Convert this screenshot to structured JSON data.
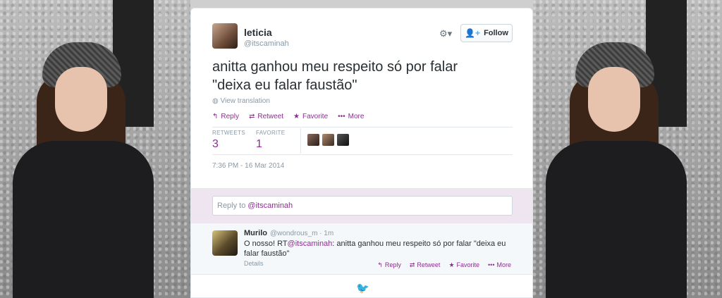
{
  "tweet": {
    "author_name": "leticia",
    "author_handle": "@itscaminah",
    "follow_label": "Follow",
    "text_line1": "anitta ganhou meu respeito só por falar",
    "text_line2": "\"deixa eu falar faustão\"",
    "view_translation": "View translation",
    "actions": {
      "reply": "Reply",
      "retweet": "Retweet",
      "favorite": "Favorite",
      "more": "More"
    },
    "stats": {
      "retweets_label": "RETWEETS",
      "retweets_count": "3",
      "favorites_label": "FAVORITE",
      "favorites_count": "1"
    },
    "timestamp": "7:36 PM - 16 Mar 2014"
  },
  "reply_box": {
    "prefix": "Reply to ",
    "mention": "@itscaminah"
  },
  "reply_tweet": {
    "author_name": "Murilo",
    "author_handle": "@wondrous_m · 1m",
    "text_before": "O nosso! RT",
    "mention": "@itscaminah",
    "text_after": ": anitta ganhou meu respeito só por falar \"deixa eu falar faustão\"",
    "details": "Details",
    "actions": {
      "reply": "Reply",
      "retweet": "Retweet",
      "favorite": "Favorite",
      "more": "More"
    }
  },
  "colors": {
    "accent": "#8c2e91",
    "reply_area_bg": "#efe5f1"
  },
  "icons": [
    "gear-icon",
    "add-user-icon",
    "reply-icon",
    "retweet-icon",
    "star-icon",
    "more-icon",
    "globe-icon",
    "twitter-bird-icon"
  ]
}
